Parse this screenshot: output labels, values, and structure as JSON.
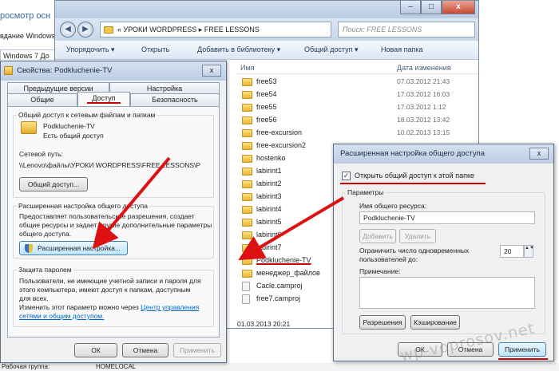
{
  "background": {
    "line1": "росмотр осн",
    "line2": "вдание Windows",
    "line3": "Windows 7 До",
    "footer_label": "Рабочая группа:",
    "footer_value": "HOMELOCAL"
  },
  "explorer": {
    "caption": {
      "minimize": "–",
      "maximize": "□",
      "close": "x"
    },
    "back": "◀",
    "forward": "▶",
    "address": "« УРОКИ WORDPRESS ▸ FREE LESSONS",
    "search_placeholder": "Поиск: FREE LESSONS",
    "toolbar": [
      "Упорядочить ▾",
      "Открыть",
      "Добавить в библиотеку ▾",
      "Общий доступ ▾",
      "Новая папка"
    ],
    "columns": {
      "name": "Имя",
      "date": "Дата изменения"
    },
    "files": [
      {
        "name": "free53",
        "date": "07.03.2012 21:43",
        "type": "folder"
      },
      {
        "name": "free54",
        "date": "17.03.2012 16:03",
        "type": "folder"
      },
      {
        "name": "free55",
        "date": "17.03.2012 1:12",
        "type": "folder"
      },
      {
        "name": "free56",
        "date": "18.03.2012 13:42",
        "type": "folder"
      },
      {
        "name": "free-excursion",
        "date": "10.02.2013 13:15",
        "type": "folder"
      },
      {
        "name": "free-excursion2",
        "date": "",
        "type": "folder"
      },
      {
        "name": "hostenko",
        "date": "",
        "type": "folder"
      },
      {
        "name": "labirint1",
        "date": "",
        "type": "folder"
      },
      {
        "name": "labirint2",
        "date": "",
        "type": "folder"
      },
      {
        "name": "labirint3",
        "date": "",
        "type": "folder"
      },
      {
        "name": "labirint4",
        "date": "",
        "type": "folder"
      },
      {
        "name": "labirint5",
        "date": "",
        "type": "folder"
      },
      {
        "name": "labirint6",
        "date": "",
        "type": "folder"
      },
      {
        "name": "labirint7",
        "date": "",
        "type": "folder"
      },
      {
        "name": "Podkluchenie-TV",
        "date": "",
        "type": "folder"
      },
      {
        "name": "менеджер_файлов",
        "date": "",
        "type": "folder"
      },
      {
        "name": "Cacle.camproj",
        "date": "",
        "type": "file"
      },
      {
        "name": "free7.camproj",
        "date": "",
        "type": "file"
      }
    ],
    "status": "01.03.2013 20:21"
  },
  "props": {
    "title": "Свойства: Podkluchenie-TV",
    "close": "x",
    "tabs_top": [
      "Предыдущие версии",
      "Настройка"
    ],
    "tabs_bottom": [
      "Общие",
      "Доступ",
      "Безопасность"
    ],
    "share_group_title": "Общий доступ к сетевым файлам и папкам",
    "folder_name": "Podkluchenie-TV",
    "shared_status": "Есть общий доступ",
    "network_path_label": "Сетевой путь:",
    "network_path": "\\\\Lenovo\\файлы\\УРОКИ WORDPRESS\\FREE LESSONS\\P",
    "share_button": "Общий доступ...",
    "adv_group_title": "Расширенная настройка общего доступа",
    "adv_desc": [
      "Предоставляет пользовательские разрешения, создает",
      "общие ресурсы и задает другие дополнительные параметры",
      "общего доступа."
    ],
    "adv_button": "Расширенная настройка...",
    "pwd_group_title": "Защита паролем",
    "pwd_desc": [
      "Пользователи, не имеющие учетной записи и пароля для",
      "этого компьютера, имеют доступ к папкам, доступным",
      "для всех."
    ],
    "pwd_change_prefix": "Изменить этот параметр можно через ",
    "pwd_link1": "Центр управления",
    "pwd_link2": "сетями и общим доступом.",
    "ok": "ОК",
    "cancel": "Отмена",
    "apply": "Применить"
  },
  "adv": {
    "title": "Расширенная настройка общего доступа",
    "close": "x",
    "check_mark": "✓",
    "checkbox_label": "Открыть общий доступ к этой папке",
    "params_title": "Параметры",
    "share_name_label": "Имя общего ресурса:",
    "share_name": "Podkluchenie-TV",
    "add": "Добавить",
    "remove": "Удалить",
    "limit_label": [
      "Ограничить число одновременных",
      "пользователей до:"
    ],
    "limit_value": "20",
    "spin": "▲▼",
    "note_label": "Примечание:",
    "permissions": "Разрешения",
    "caching": "Кэширование",
    "ok": "ОК",
    "cancel": "Отмена",
    "apply": "Применить"
  },
  "watermark": "wp-voprosov.net"
}
